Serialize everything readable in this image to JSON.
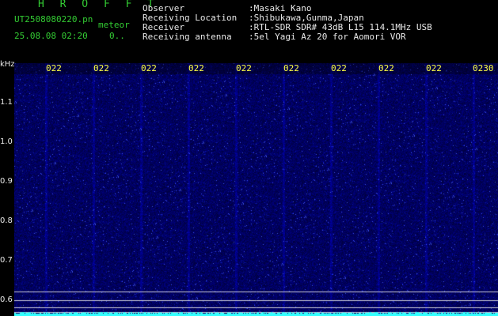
{
  "header": {
    "logo": "H R O F F T",
    "filename": "UT2508080220.pn",
    "tag": "meteor",
    "datetime": "25.08.08 02:20",
    "count": "0..",
    "rows": [
      {
        "label": "Observer",
        "value": ":Masaki Kano"
      },
      {
        "label": "Receiving Location",
        "value": ":Shibukawa,Gunma,Japan"
      },
      {
        "label": "Receiver",
        "value": ":RTL-SDR SDR# 43dB L15 114.1MHz USB"
      },
      {
        "label": "Receiving antenna",
        "value": ":5el Yagi Az 20 for Aomori VOR"
      }
    ]
  },
  "axis": {
    "unit": "kHz",
    "y_ticks": [
      "1.1",
      "1.0",
      "0.9",
      "0.8",
      "0.7",
      "0.6"
    ],
    "x_ticks": [
      "022",
      "022",
      "022",
      "022",
      "022",
      "022",
      "022",
      "022",
      "022",
      "0230"
    ]
  },
  "colors": {
    "background": "#000000",
    "waterfall": "#0a0a7a",
    "tick_yellow": "#ffff44",
    "header_green": "#33cc33",
    "baseline_cyan": "#33ffff"
  }
}
